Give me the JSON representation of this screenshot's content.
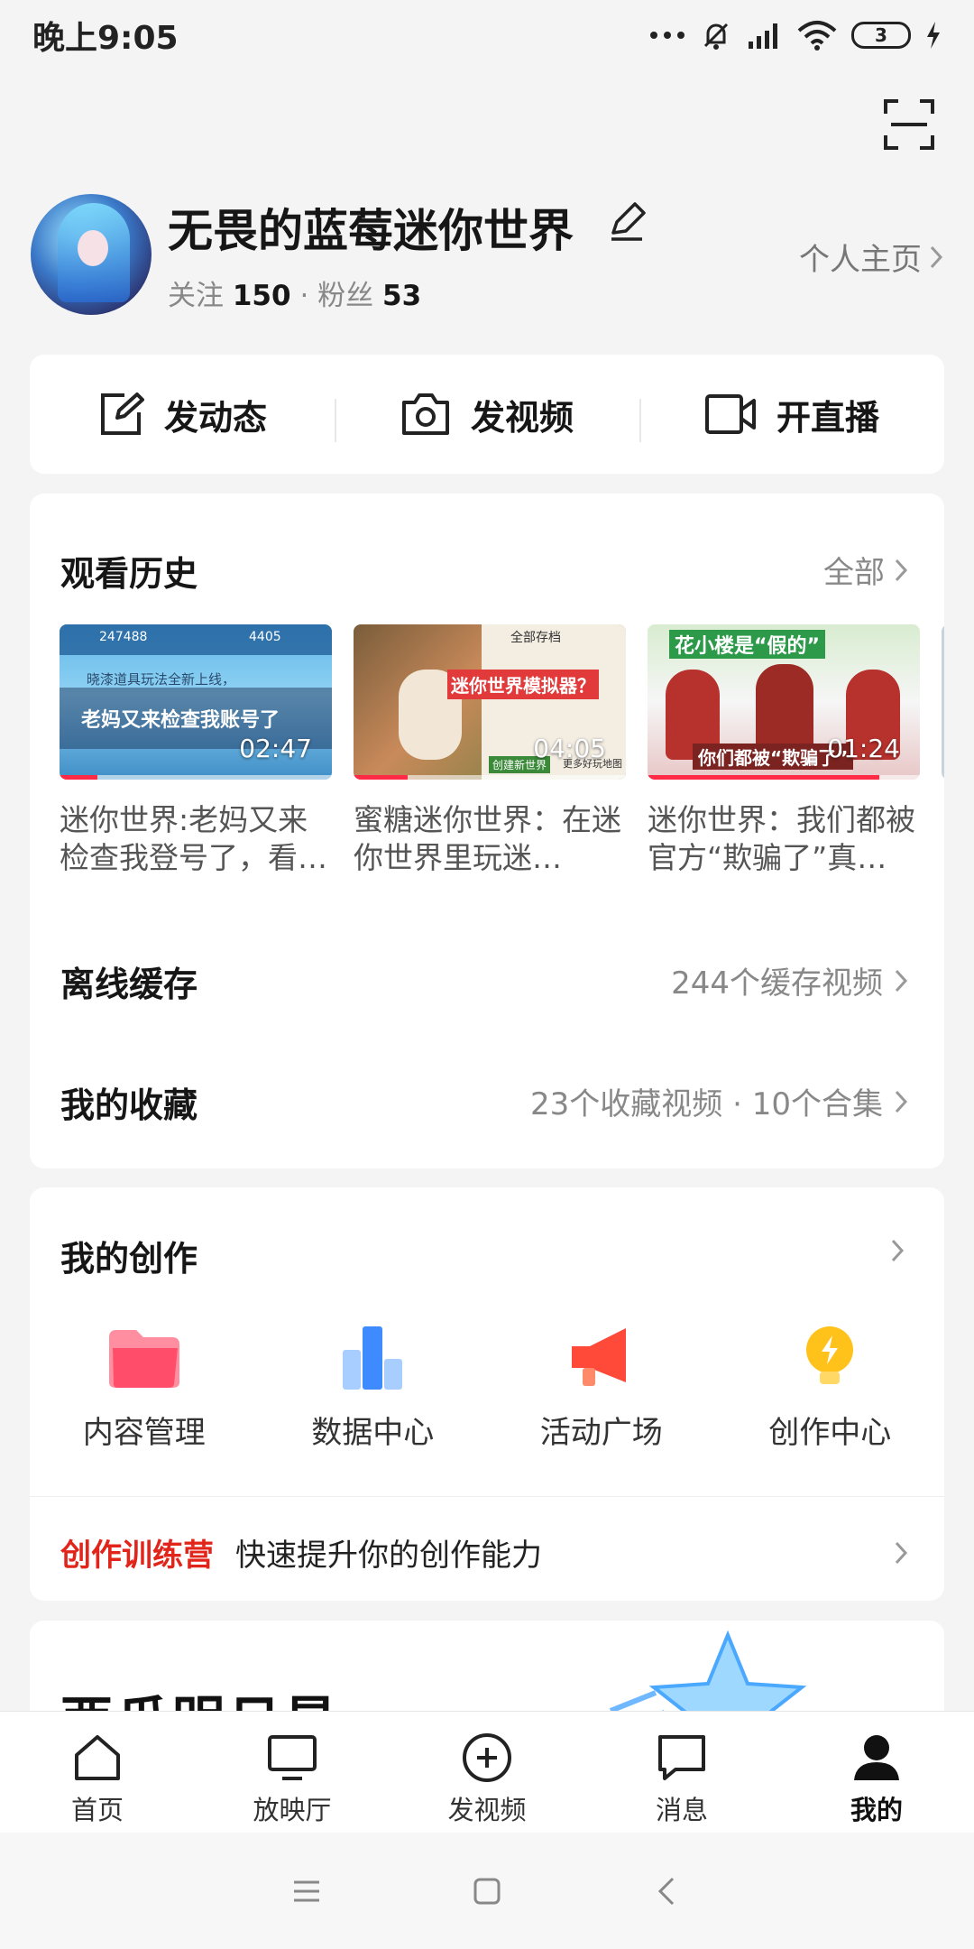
{
  "status_bar": {
    "time": "晚上9:05",
    "battery": "3"
  },
  "profile": {
    "username": "无畏的蓝莓迷你世界",
    "following_label": "关注",
    "following_count": "150",
    "separator": "·",
    "followers_label": "粉丝",
    "followers_count": "53",
    "homepage_label": "个人主页"
  },
  "actions": [
    {
      "label": "发动态",
      "icon": "edit-square-icon"
    },
    {
      "label": "发视频",
      "icon": "camera-icon"
    },
    {
      "label": "开直播",
      "icon": "video-camera-icon"
    }
  ],
  "history": {
    "title": "观看历史",
    "more_label": "全部",
    "videos": [
      {
        "title": "迷你世界:老妈又来检查我登号了，看…",
        "duration": "02:47",
        "progress": 0.14,
        "thumb_text": "老妈又来检查我账号了",
        "thumb_sub": "晓漆道具玩法全新上线，",
        "hud_left": "247488",
        "hud_right": "4405"
      },
      {
        "title": "蜜糖迷你世界：在迷你世界里玩迷…",
        "duration": "04:05",
        "progress": 0.2,
        "thumb_text": "迷你世界模拟器？",
        "thumb_sub": "全部存档",
        "hud_left": "创建新世界",
        "hud_right": "更多好玩地图"
      },
      {
        "title": "迷你世界：我们都被官方“欺骗了”真…",
        "duration": "01:24",
        "progress": 0.85,
        "thumb_text": "花小楼是“假的”",
        "thumb_sub": "你们都被“欺骗了”",
        "hud_left": "",
        "hud_right": ""
      }
    ]
  },
  "offline": {
    "title": "离线缓存",
    "more_label": "244个缓存视频"
  },
  "favorites": {
    "title": "我的收藏",
    "more_label": "23个收藏视频 · 10个合集"
  },
  "creation": {
    "title": "我的创作",
    "tools": [
      {
        "label": "内容管理",
        "icon": "folder-icon"
      },
      {
        "label": "数据中心",
        "icon": "bar-chart-icon"
      },
      {
        "label": "活动广场",
        "icon": "megaphone-icon"
      },
      {
        "label": "创作中心",
        "icon": "lightbulb-icon"
      }
    ],
    "camp_tag": "创作训练营",
    "camp_text": "快速提升你的创作能力"
  },
  "banner": {
    "title": "西瓜明日星"
  },
  "tabbar": [
    {
      "label": "首页",
      "icon": "home-icon",
      "active": false
    },
    {
      "label": "放映厅",
      "icon": "tv-icon",
      "active": false
    },
    {
      "label": "发视频",
      "icon": "plus-circle-icon",
      "active": false
    },
    {
      "label": "消息",
      "icon": "message-icon",
      "active": false
    },
    {
      "label": "我的",
      "icon": "person-icon",
      "active": true
    }
  ],
  "colors": {
    "accent_red": "#e1251b",
    "progress_red": "#ff2b46"
  }
}
